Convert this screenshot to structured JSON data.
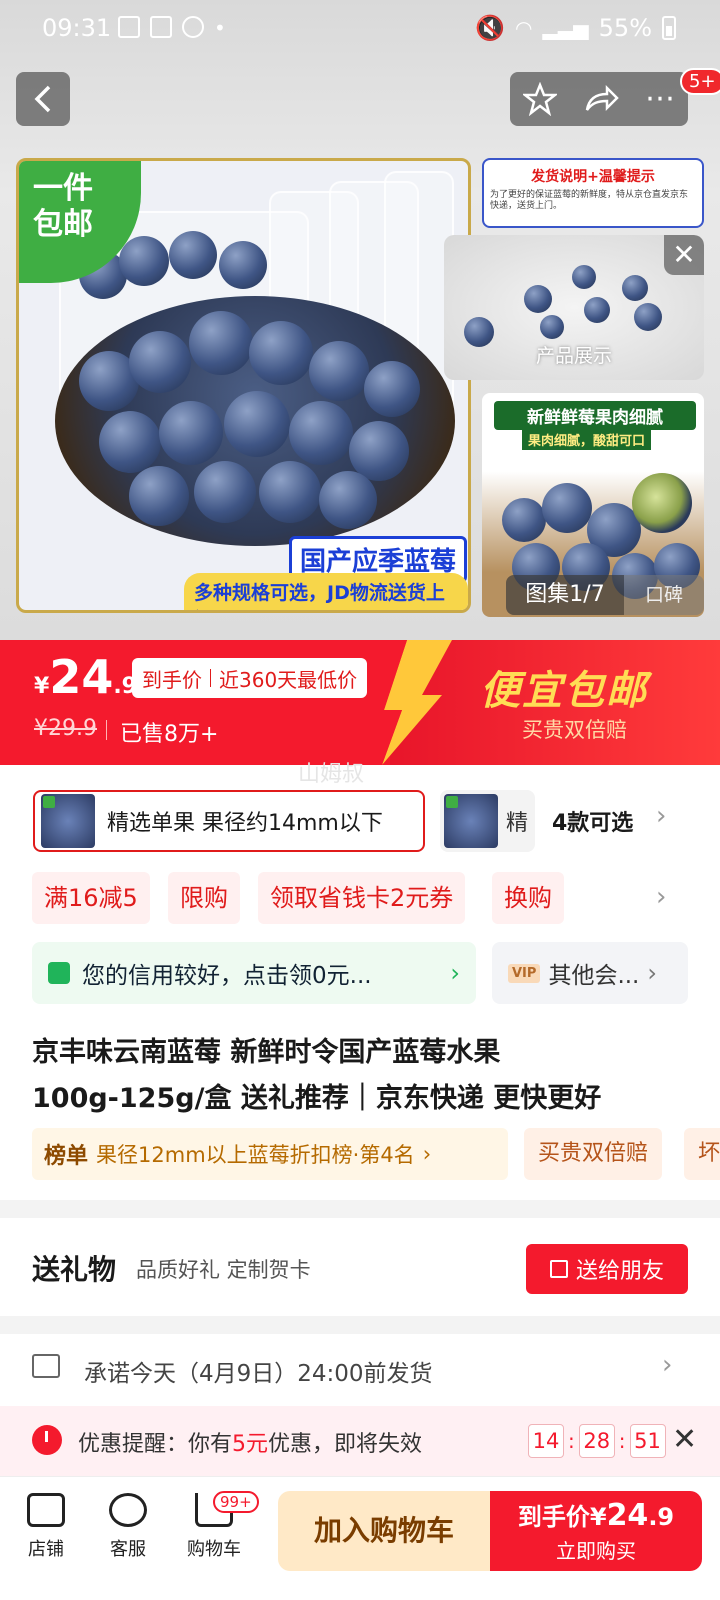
{
  "status_bar": {
    "time": "09:31",
    "battery": "55%"
  },
  "header": {
    "cart_badge": "5+"
  },
  "gallery": {
    "corner_badge_line1": "一件",
    "corner_badge_line2": "包邮",
    "main_label1": "国产应季蓝莓",
    "main_label2": "多种规格可选，JD物流送货上门",
    "thumb1_title": "发货说明+温馨提示",
    "thumb1_text": "为了更好的保证蓝莓的新鲜度，特从京仓直发京东快递，送货上门。",
    "video_caption": "产品展示",
    "thumb2_title": "新鲜鲜莓果肉细腻",
    "thumb2_sub": "果肉细腻，酸甜可口",
    "count": "图集1/7",
    "review_tab": "口碑"
  },
  "price": {
    "currency": "¥",
    "integer": "24",
    "decimal": ".9",
    "tag_a": "到手价",
    "tag_b": "近360天最低价",
    "original": "¥29.9",
    "sold": "已售8万+",
    "promo_title": "便宜包邮",
    "promo_sub": "买贵双倍赔",
    "watermark": "山姆叔"
  },
  "variants": {
    "selected": "精选单果 果径约14mm以下",
    "other": "精",
    "count_label": "4款可选"
  },
  "coupons": [
    "满16减5",
    "限购",
    "领取省钱卡2元券",
    "换购"
  ],
  "credit": {
    "text": "您的信用较好，点击领0元...",
    "member_badge": "VIP",
    "member_text": "其他会..."
  },
  "product": {
    "title_line1": "京丰味云南蓝莓 新鲜时令国产蓝莓水果",
    "title_line2": "100g-125g/盒 送礼推荐｜京东快递 更快更好",
    "rank_key": "榜单",
    "rank_value": "果径12mm以上蓝莓折扣榜·第4名",
    "pill1": "买贵双倍赔",
    "pill2": "坏"
  },
  "gift": {
    "title": "送礼物",
    "subtitle": "品质好礼 定制贺卡",
    "button": "送给朋友"
  },
  "shipping": {
    "text": "承诺今天（4月9日）24:00前发货"
  },
  "reminder": {
    "prefix": "优惠提醒：你有",
    "amount": "5元",
    "suffix": "优惠，即将失效",
    "hh": "14",
    "mm": "28",
    "ss": "51"
  },
  "bottom": {
    "store": "店铺",
    "service": "客服",
    "cart": "购物车",
    "cart_badge": "99+",
    "add_to_cart": "加入购物车",
    "buy_price_label": "到手价",
    "buy_price_cur": "¥",
    "buy_price_int": "24",
    "buy_price_dec": ".9",
    "buy_now": "立即购买"
  },
  "colors": {
    "brand_red": "#f41a2d",
    "gold": "#ffdd55",
    "green": "#3fae43"
  }
}
